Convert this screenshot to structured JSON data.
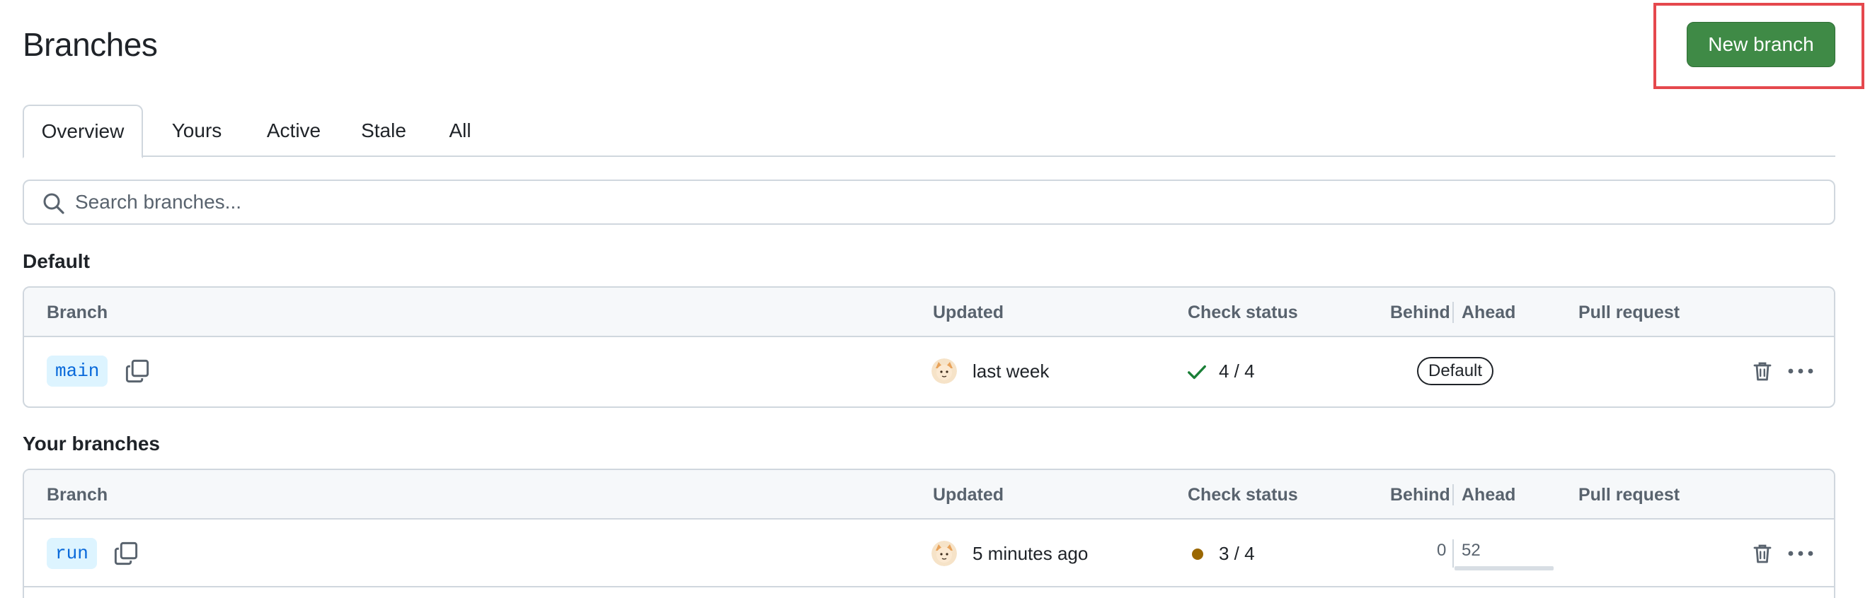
{
  "header": {
    "title": "Branches",
    "new_branch_label": "New branch"
  },
  "tabs": [
    {
      "label": "Overview",
      "active": true
    },
    {
      "label": "Yours",
      "active": false
    },
    {
      "label": "Active",
      "active": false
    },
    {
      "label": "Stale",
      "active": false
    },
    {
      "label": "All",
      "active": false
    }
  ],
  "search": {
    "placeholder": "Search branches..."
  },
  "columns": {
    "branch": "Branch",
    "updated": "Updated",
    "check_status": "Check status",
    "behind": "Behind",
    "ahead": "Ahead",
    "pull_request": "Pull request"
  },
  "sections": {
    "default": {
      "title": "Default",
      "row": {
        "branch": "main",
        "updated": "last week",
        "check_icon": "check-icon",
        "check": "4 / 4",
        "badge": "Default"
      }
    },
    "yours": {
      "title": "Your branches",
      "row": {
        "branch": "run",
        "updated": "5 minutes ago",
        "check_icon": "pending-dot",
        "check": "3 / 4",
        "behind": "0",
        "ahead": "52"
      }
    }
  },
  "colors": {
    "primary_button": "#3f8a46",
    "highlight_box": "#e5484d",
    "success": "#1a7f37",
    "pending": "#9a6700",
    "branch_chip_bg": "#ddf4ff",
    "branch_chip_text": "#0969da"
  }
}
